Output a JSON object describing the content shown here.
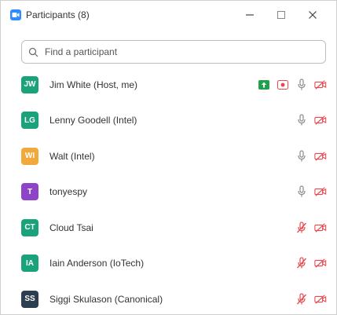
{
  "window": {
    "title": "Participants (8)"
  },
  "search": {
    "placeholder": "Find a participant"
  },
  "participants": [
    {
      "initials": "JW",
      "name": "Jim White (Host, me)",
      "avatar_color": "#1aa37a",
      "share": true,
      "record": true,
      "mic": "on",
      "video": "off"
    },
    {
      "initials": "LG",
      "name": "Lenny Goodell (Intel)",
      "avatar_color": "#1aa37a",
      "share": false,
      "record": false,
      "mic": "on",
      "video": "off"
    },
    {
      "initials": "WI",
      "name": "Walt (Intel)",
      "avatar_color": "#f2a93b",
      "share": false,
      "record": false,
      "mic": "on",
      "video": "off"
    },
    {
      "initials": "T",
      "name": "tonyespy",
      "avatar_color": "#8e44c9",
      "share": false,
      "record": false,
      "mic": "on",
      "video": "off"
    },
    {
      "initials": "CT",
      "name": "Cloud Tsai",
      "avatar_color": "#1aa37a",
      "share": false,
      "record": false,
      "mic": "muted",
      "video": "off"
    },
    {
      "initials": "IA",
      "name": "Iain Anderson (IoTech)",
      "avatar_color": "#1aa37a",
      "share": false,
      "record": false,
      "mic": "muted",
      "video": "off"
    },
    {
      "initials": "SS",
      "name": "Siggi Skulason (Canonical)",
      "avatar_color": "#2c3e50",
      "share": false,
      "record": false,
      "mic": "muted",
      "video": "off"
    }
  ],
  "colors": {
    "accent": "#2d8cff",
    "muted_red": "#e8474f",
    "mic_gray": "#8a8a8a",
    "share_green": "#23a04b"
  }
}
